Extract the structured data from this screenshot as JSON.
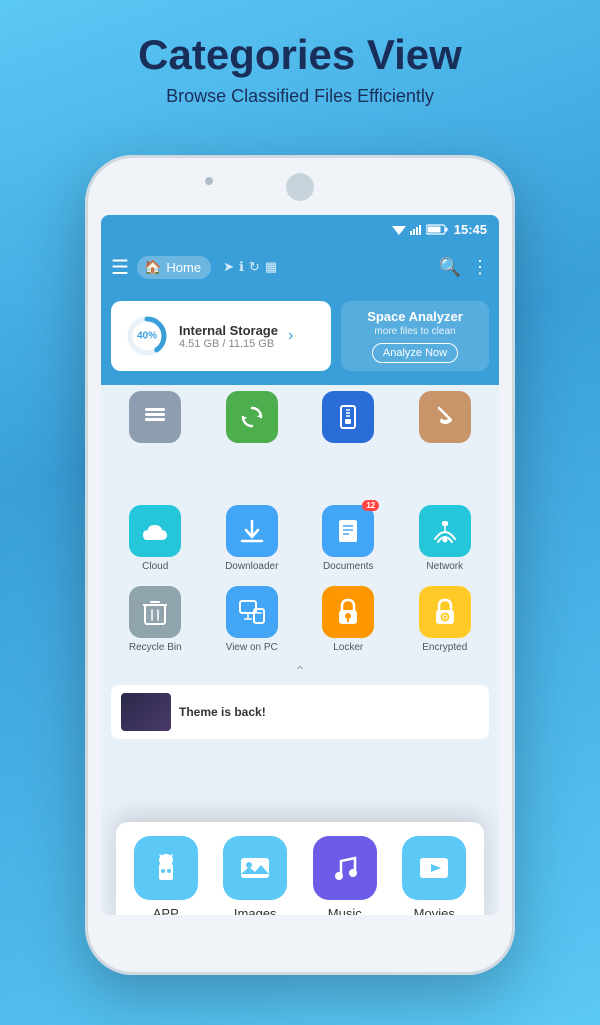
{
  "header": {
    "title": "Categories View",
    "subtitle": "Browse Classified Files Efficiently"
  },
  "statusBar": {
    "time": "15:45"
  },
  "toolbar": {
    "homeLabel": "Home",
    "searchTitle": "Search",
    "moreTitle": "More"
  },
  "storage": {
    "percent": "40%",
    "title": "Internal Storage",
    "details": "4.51 GB / 11.15 GB"
  },
  "spaceAnalyzer": {
    "title": "Space Analyzer",
    "subtitle": "more files to clean",
    "buttonLabel": "Analyze Now"
  },
  "topCategories": [
    {
      "id": "layers",
      "color": "#7a8fa0",
      "label": ""
    },
    {
      "id": "sync",
      "color": "#4cae4c",
      "label": ""
    },
    {
      "id": "zip",
      "color": "#2a6dd9",
      "label": ""
    },
    {
      "id": "broom",
      "color": "#b87c50",
      "label": ""
    }
  ],
  "mainCategories": [
    {
      "id": "app",
      "label": "APP",
      "color": "#5bc8f5",
      "icon": "🤖"
    },
    {
      "id": "images",
      "label": "Images",
      "color": "#5bc8f5",
      "icon": "🖼"
    },
    {
      "id": "music",
      "label": "Music",
      "color": "#6c5ce7",
      "icon": "🎵"
    },
    {
      "id": "movies",
      "label": "Movies",
      "color": "#5bc8f5",
      "icon": "▶"
    }
  ],
  "secondRowCategories": [
    {
      "id": "cloud",
      "label": "Cloud",
      "color": "#26c6da",
      "icon": "☁"
    },
    {
      "id": "downloader",
      "label": "Downloader",
      "color": "#42a5f5",
      "icon": "⬇"
    },
    {
      "id": "documents",
      "label": "Documents",
      "color": "#42a5f5",
      "badge": "12",
      "icon": "📄"
    },
    {
      "id": "network",
      "label": "Network",
      "color": "#26c6da",
      "icon": "📶"
    }
  ],
  "thirdRowCategories": [
    {
      "id": "recycle",
      "label": "Recycle Bin",
      "color": "#90a4ae",
      "icon": "🗑"
    },
    {
      "id": "viewonpc",
      "label": "View on PC",
      "color": "#42a5f5",
      "icon": "🖥"
    },
    {
      "id": "locker",
      "label": "Locker",
      "color": "#ff9800",
      "icon": "🔒"
    },
    {
      "id": "encrypted",
      "label": "Encrypted",
      "color": "#ffca28",
      "icon": "🔐"
    }
  ],
  "themeBanner": {
    "text": "Theme is back!"
  }
}
